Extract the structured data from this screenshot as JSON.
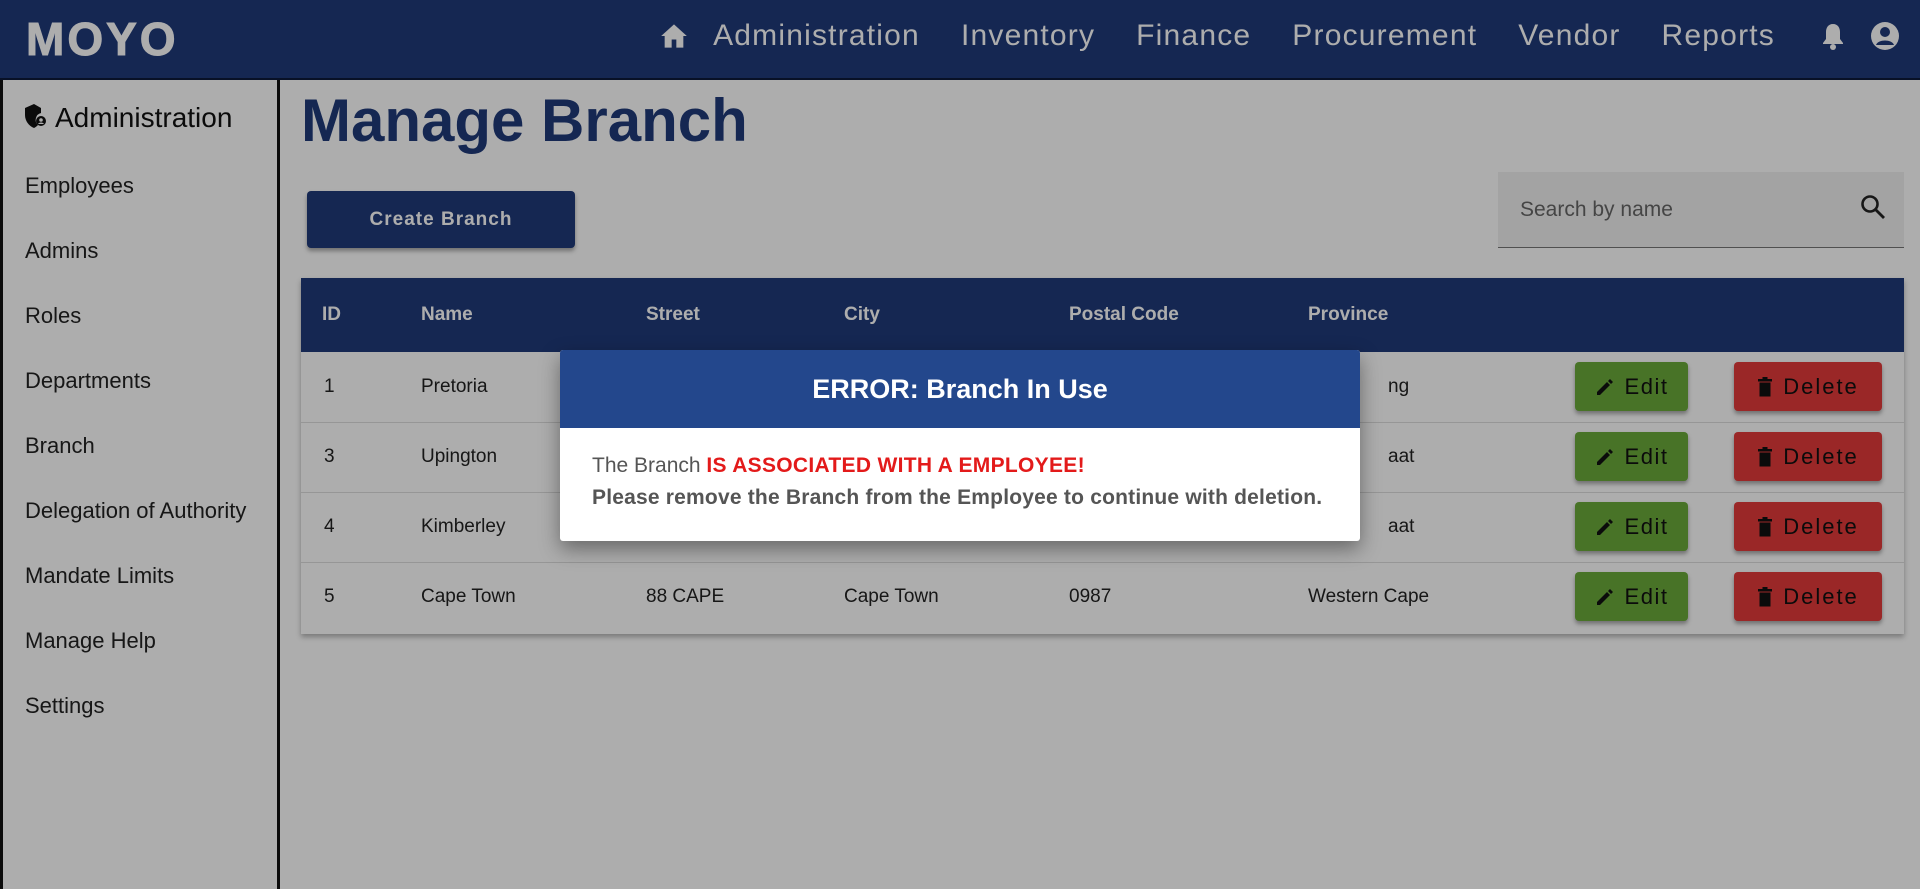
{
  "brand": {
    "logo": "MOYO"
  },
  "nav": {
    "items": [
      "Administration",
      "Inventory",
      "Finance",
      "Procurement",
      "Vendor",
      "Reports"
    ],
    "icons": [
      "home-icon",
      "bell-icon",
      "account-icon"
    ]
  },
  "sidebar": {
    "title": "Administration",
    "items": [
      {
        "label": "Employees"
      },
      {
        "label": "Admins"
      },
      {
        "label": "Roles"
      },
      {
        "label": "Departments"
      },
      {
        "label": "Branch"
      },
      {
        "label": "Delegation of Authority"
      },
      {
        "label": "Mandate Limits"
      },
      {
        "label": "Manage Help"
      },
      {
        "label": "Settings"
      }
    ]
  },
  "main": {
    "title": "Manage Branch",
    "create_label": "Create Branch",
    "search_placeholder": "Search by name"
  },
  "table": {
    "headers": [
      "ID",
      "Name",
      "Street",
      "City",
      "Postal Code",
      "Province"
    ],
    "rows": [
      {
        "id": "1",
        "name": "Pretoria",
        "street": "",
        "city": "",
        "postal": "",
        "province": "ng"
      },
      {
        "id": "3",
        "name": "Upington",
        "street": "",
        "city": "",
        "postal": "",
        "province": "aat"
      },
      {
        "id": "4",
        "name": "Kimberley",
        "street": "",
        "city": "",
        "postal": "",
        "province": "aat"
      },
      {
        "id": "5",
        "name": "Cape Town",
        "street": "88 CAPE",
        "city": "Cape Town",
        "postal": "0987",
        "province": "Western Cape"
      }
    ],
    "edit_label": "Edit",
    "delete_label": "Delete"
  },
  "dialog": {
    "title": "ERROR: Branch In Use",
    "line1_prefix": "The Branch ",
    "line1_warning": "IS ASSOCIATED WITH A EMPLOYEE!",
    "line2": "Please remove the Branch from the Employee to continue with deletion."
  },
  "colors": {
    "primary": "#1f3a7a",
    "dialog_header": "#23478c",
    "edit": "#6aaa3a",
    "delete": "#e33a3a",
    "warning_text": "#e31a1a"
  }
}
